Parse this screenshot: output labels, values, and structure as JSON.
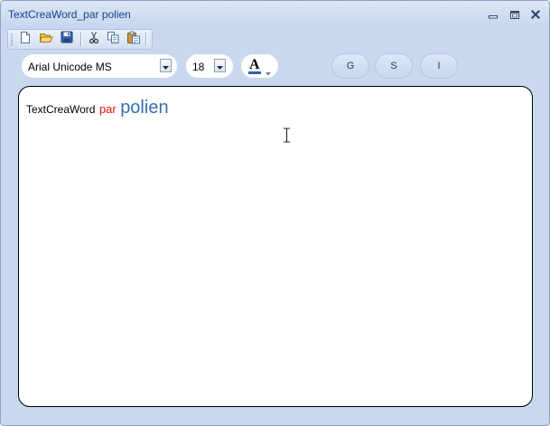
{
  "window": {
    "title": "TextCreaWord_par polien",
    "controls": [
      "minimize-icon",
      "restore-icon",
      "close-icon"
    ]
  },
  "toolbar": {
    "buttons": [
      {
        "icon": "new-file-icon",
        "tooltip": ""
      },
      {
        "icon": "open-folder-icon",
        "tooltip": ""
      },
      {
        "icon": "save-icon",
        "tooltip": ""
      },
      {
        "icon": "cut-icon",
        "tooltip": ""
      },
      {
        "icon": "copy-icon",
        "tooltip": ""
      },
      {
        "icon": "paste-icon",
        "tooltip": ""
      }
    ]
  },
  "format": {
    "font_name": "Arial Unicode MS",
    "font_size": "18",
    "text_color_icon": "font-color-icon",
    "text_color_letter": "A",
    "text_color_underline": "#2c5fb0",
    "bold_label": "G",
    "underline_label": "S",
    "italic_label": "I"
  },
  "editor": {
    "words": [
      {
        "text": "TextCreaWord",
        "color": "#000000"
      },
      {
        "text": "par",
        "color": "#e81010"
      },
      {
        "text": "polien",
        "color": "#3a6fb0"
      }
    ],
    "cursor": "text-ibeam-icon"
  },
  "colors": {
    "frame": "#c9d8ee",
    "title_text": "#15428b",
    "accent": "#3a6fb0"
  }
}
